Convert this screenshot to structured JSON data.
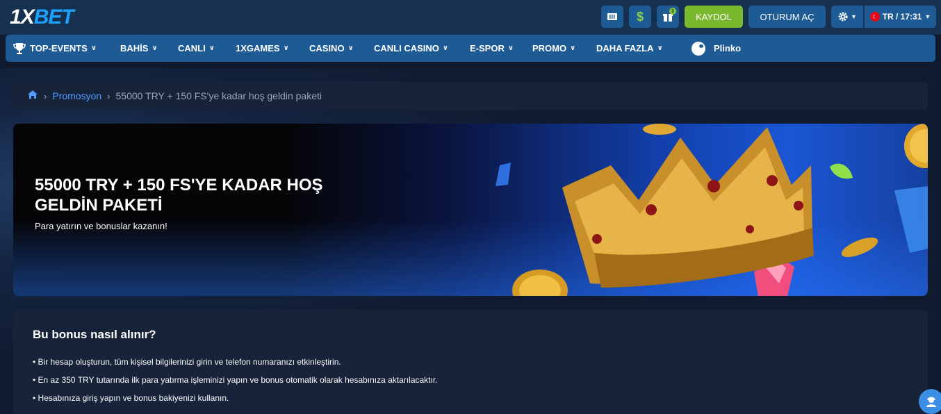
{
  "header": {
    "logo": {
      "part1": "1",
      "part2": "X",
      "part3": "BET"
    },
    "gift_badge": "1",
    "register_label": "KAYDOL",
    "login_label": "OTURUM AÇ",
    "lang_label": "TR / 17:31",
    "colors": {
      "accent_green": "#7ab92e",
      "button_blue": "#1e5a94",
      "link_blue": "#4f9bff"
    }
  },
  "nav": {
    "items": [
      {
        "label": "TOP-EVENTS",
        "icon": "trophy-icon"
      },
      {
        "label": "BAHİS"
      },
      {
        "label": "CANLI"
      },
      {
        "label": "1XGAMES"
      },
      {
        "label": "CASINO"
      },
      {
        "label": "CANLI CASINO"
      },
      {
        "label": "E-SPOR"
      },
      {
        "label": "PROMO"
      },
      {
        "label": "DAHA FAZLA"
      }
    ],
    "plinko_label": "Plinko"
  },
  "breadcrumb": {
    "link": "Promosyon",
    "current": "55000 TRY + 150 FS'ye kadar hoş geldin paketi"
  },
  "banner": {
    "title": "55000 TRY + 150 FS'YE KADAR HOŞ GELDİN PAKETİ",
    "subtitle": "Para yatırın ve bonuslar kazanın!"
  },
  "info": {
    "title": "Bu bonus nasıl alınır?",
    "items": [
      "• Bir hesap oluşturun, tüm kişisel bilgilerinizi girin ve telefon numaranızı etkinleştirin.",
      "• En az 350 TRY tutarında ilk para yatırma işleminizi yapın ve bonus otomatik olarak hesabınıza aktarılacaktır.",
      "• Hesabınıza giriş yapın ve bonus bakiyenizi kullanın."
    ]
  }
}
